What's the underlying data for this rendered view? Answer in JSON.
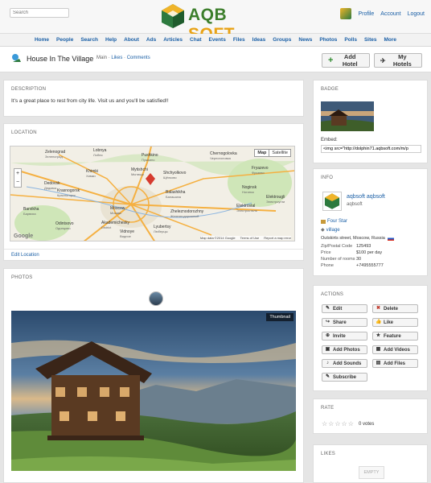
{
  "header": {
    "search_placeholder": "Search",
    "logo_text_1": "AQB",
    "logo_text_2": " SOFT",
    "user_links": [
      "Profile",
      "Account",
      "Logout"
    ]
  },
  "nav": [
    "Home",
    "People",
    "Search",
    "Help",
    "About",
    "Ads",
    "Articles",
    "Chat",
    "Events",
    "Files",
    "Ideas",
    "Groups",
    "News",
    "Photos",
    "Polls",
    "Sites",
    "More"
  ],
  "page": {
    "title": "House In The Village",
    "links": {
      "main": "Main",
      "sep": "·",
      "likes": "Likes",
      "sep2": "·",
      "comments": "Comments"
    },
    "add_hotel": "Add Hotel",
    "my_hotels": "My Hotels"
  },
  "description": {
    "header": "DESCRIPTION",
    "text": "It's a great place to rest from city life. Visit us and you'll be satisfied!!"
  },
  "location": {
    "header": "LOCATION",
    "edit_link": "Edit Location",
    "map_btn": "Map",
    "satellite_btn": "Satellite",
    "google": "Google",
    "map_footer": [
      "Map data ©2014 Google",
      "Terms of Use",
      "Report a map error"
    ],
    "places": [
      {
        "name": "Zelenograd",
        "sub": "Зеленоград"
      },
      {
        "name": "Lobnya",
        "sub": "Лобня"
      },
      {
        "name": "Pushkino",
        "sub": "Пушкино"
      },
      {
        "name": "Chernogolovka",
        "sub": "Черноголовка"
      },
      {
        "name": "Khimki",
        "sub": "Химки"
      },
      {
        "name": "Mytishchi",
        "sub": "Мытищи"
      },
      {
        "name": "Shchyolkovo",
        "sub": "Щёлково"
      },
      {
        "name": "Fryazevo",
        "sub": "Фрязево"
      },
      {
        "name": "Dedovsk",
        "sub": "Дедовск"
      },
      {
        "name": "Krasnogorsk",
        "sub": "Красногорск"
      },
      {
        "name": "Balashikha",
        "sub": "Балашиха"
      },
      {
        "name": "Noginsk",
        "sub": "Ногинск"
      },
      {
        "name": "Elektrougli",
        "sub": "Электроугли"
      },
      {
        "name": "Moscow",
        "sub": "Москва"
      },
      {
        "name": "Zheleznodorozhny",
        "sub": "Железнодорожный"
      },
      {
        "name": "Elektrostal",
        "sub": "Электросталь"
      },
      {
        "name": "Odintsovo",
        "sub": "Одинцово"
      },
      {
        "name": "Akademichesky",
        "sub": "District"
      },
      {
        "name": "Lyubertsy",
        "sub": "Люберцы"
      },
      {
        "name": "Barvikha",
        "sub": "Барвиха"
      },
      {
        "name": "Vidnoye",
        "sub": "Видное"
      }
    ]
  },
  "photos": {
    "header": "PHOTOS",
    "thumbnail_label": "Thumbnail"
  },
  "badge": {
    "header": "BADGE",
    "embed_label": "Embed:",
    "embed_code": "<img src=\"http://dolphin71.aqbsoft.com/m/p"
  },
  "info": {
    "header": "INFO",
    "author_name": "aqbsoft aqbsoft",
    "author_sub": "aqbsoft",
    "category": "Four Star",
    "tag": "village",
    "address": "Outskirts street, Moscow, Russia",
    "fields": [
      {
        "label": "Zip/Postal Code",
        "value": "125493"
      },
      {
        "label": "Price",
        "value": "$100 per day"
      },
      {
        "label": "Number of rooms",
        "value": "30"
      },
      {
        "label": "Phone",
        "value": "+7495555777"
      }
    ]
  },
  "actions": {
    "header": "ACTIONS",
    "buttons": [
      {
        "label": "Edit",
        "icon": "pencil-icon"
      },
      {
        "label": "Delete",
        "icon": "x-icon"
      },
      {
        "label": "Share",
        "icon": "share-icon"
      },
      {
        "label": "Like",
        "icon": "thumbs-up-icon"
      },
      {
        "label": "Invite",
        "icon": "plus-circle-icon"
      },
      {
        "label": "Feature",
        "icon": "star-icon"
      },
      {
        "label": "Add Photos",
        "icon": "image-icon"
      },
      {
        "label": "Add Videos",
        "icon": "film-icon"
      },
      {
        "label": "Add Sounds",
        "icon": "music-icon"
      },
      {
        "label": "Add Files",
        "icon": "folder-icon"
      },
      {
        "label": "Subscribe",
        "icon": "bell-icon"
      }
    ]
  },
  "rate": {
    "header": "RATE",
    "votes": "0 votes",
    "stars_filled": 0,
    "stars_total": 5
  },
  "likes": {
    "header": "LIKES",
    "empty": "EMPTY"
  },
  "colors": {
    "link": "#1a5fa6",
    "logo_green": "#3c7e2b",
    "logo_orange": "#e8a317",
    "delete_red": "#c0392b",
    "add_green": "#2e8b2e"
  }
}
